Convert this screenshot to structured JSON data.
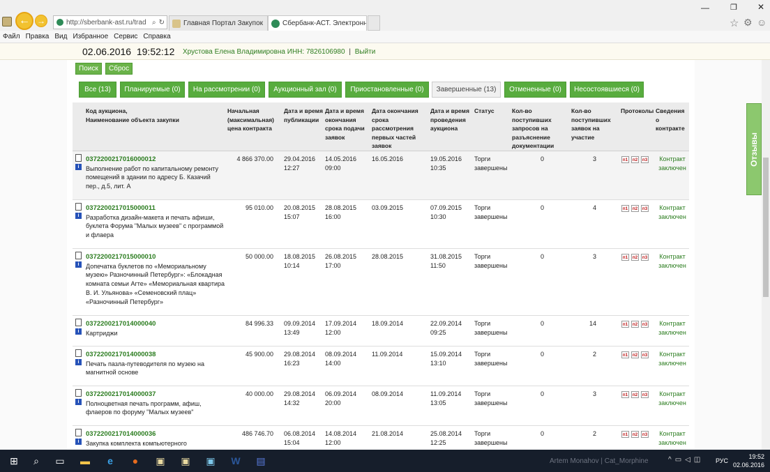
{
  "browser": {
    "url": "http://sberbank-ast.ru/trad",
    "tabs": [
      "Главная Портал Закупок",
      "Сбербанк-АСТ. Электронн..."
    ]
  },
  "menu": [
    "Файл",
    "Правка",
    "Вид",
    "Избранное",
    "Сервис",
    "Справка"
  ],
  "info": {
    "date": "02.06.2016",
    "time": "19:52:12",
    "user": "Хрустова Елена Владимировна ИНН: 7826106980",
    "separator": "|",
    "logout": "Выйти"
  },
  "buttons": {
    "search": "Поиск",
    "reset": "Сброс"
  },
  "filters": [
    "Все (13)",
    "Планируемые (0)",
    "На рассмотрении (0)",
    "Аукционный зал (0)",
    "Приостановленные (0)",
    "Завершенные (13)",
    "Отмененные (0)",
    "Несостоявшиеся (0)"
  ],
  "headers": {
    "code": "Код аукциона,",
    "name": "Наименование объекта закупки",
    "price": "Начальная (максимальная) цена контракта",
    "pub": "Дата и время публикации",
    "end_apply": "Дата и время окончания срока подачи заявок",
    "end_review": "Дата окончания срока рассмотрения первых частей заявок",
    "auction": "Дата и время проведения аукциона",
    "status": "Статус",
    "requests": "Кол-во поступивших запросов на разъяснение документации",
    "apps": "Кол-во поступивших заявок на участие",
    "protocols": "Протоколы",
    "contract": "Сведения о контракте"
  },
  "rows": [
    {
      "code": "0372200217016000012",
      "name": "Выполнение работ по капитальному ремонту помещений в здании по адресу Б. Казачий пер., д.5, лит. А",
      "price": "4 866 370.00",
      "pub_date": "29.04.2016",
      "pub_time": "12:27",
      "apply_date": "14.05.2016",
      "apply_time": "09:00",
      "review": "16.05.2016",
      "auction_date": "19.05.2016",
      "auction_time": "10:35",
      "status1": "Торги",
      "status2": "завершены",
      "requests": "0",
      "apps": "3",
      "p1": "п1",
      "p2": "п2",
      "p3": "п3",
      "contract1": "Контракт",
      "contract2": "заключен"
    },
    {
      "code": "0372200217015000011",
      "name": "Разработка дизайн-макета и печать афиши, буклета Форума \"Малых музеев\" с программой и флаера",
      "price": "95 010.00",
      "pub_date": "20.08.2015",
      "pub_time": "15:07",
      "apply_date": "28.08.2015",
      "apply_time": "16:00",
      "review": "03.09.2015",
      "auction_date": "07.09.2015",
      "auction_time": "10:30",
      "status1": "Торги",
      "status2": "завершены",
      "requests": "0",
      "apps": "4",
      "p1": "п1",
      "p2": "п2",
      "p3": "п3",
      "contract1": "Контракт",
      "contract2": "заключен"
    },
    {
      "code": "0372200217015000010",
      "name": "Допечатка буклетов по «Мемориальному музею» Разночинный Петербург»: «Блокадная комната семьи Агте» «Мемориальная квартира В. И. Ульянова» «Семеновский плац» «Разночинный Петербург»",
      "price": "50 000.00",
      "pub_date": "18.08.2015",
      "pub_time": "10:14",
      "apply_date": "26.08.2015",
      "apply_time": "17:00",
      "review": "28.08.2015",
      "auction_date": "31.08.2015",
      "auction_time": "11:50",
      "status1": "Торги",
      "status2": "завершены",
      "requests": "0",
      "apps": "3",
      "p1": "п1",
      "p2": "п2",
      "p3": "п3",
      "contract1": "Контракт",
      "contract2": "заключен"
    },
    {
      "code": "0372200217014000040",
      "name": "Картриджи",
      "price": "84 996.33",
      "pub_date": "09.09.2014",
      "pub_time": "13:49",
      "apply_date": "17.09.2014",
      "apply_time": "12:00",
      "review": "18.09.2014",
      "auction_date": "22.09.2014",
      "auction_time": "09:25",
      "status1": "Торги",
      "status2": "завершены",
      "requests": "0",
      "apps": "14",
      "p1": "п1",
      "p2": "п2",
      "p3": "п3",
      "contract1": "Контракт",
      "contract2": "заключен"
    },
    {
      "code": "0372200217014000038",
      "name": "Печать пазла-путеводителя по музею на магнитной основе",
      "price": "45 900.00",
      "pub_date": "29.08.2014",
      "pub_time": "16:23",
      "apply_date": "08.09.2014",
      "apply_time": "14:00",
      "review": "11.09.2014",
      "auction_date": "15.09.2014",
      "auction_time": "13:10",
      "status1": "Торги",
      "status2": "завершены",
      "requests": "0",
      "apps": "2",
      "p1": "п1",
      "p2": "п2",
      "p3": "п3",
      "contract1": "Контракт",
      "contract2": "заключен"
    },
    {
      "code": "0372200217014000037",
      "name": "Полноцветная печать программ, афиш, флаеров по форуму \"Малых музеев\"",
      "price": "40 000.00",
      "pub_date": "29.08.2014",
      "pub_time": "14:32",
      "apply_date": "06.09.2014",
      "apply_time": "20:00",
      "review": "08.09.2014",
      "auction_date": "11.09.2014",
      "auction_time": "13:05",
      "status1": "Торги",
      "status2": "завершены",
      "requests": "0",
      "apps": "3",
      "p1": "п1",
      "p2": "п2",
      "p3": "п3",
      "contract1": "Контракт",
      "contract2": "заключен"
    },
    {
      "code": "0372200217014000036",
      "name": "Закупка комплекта компьютерного",
      "price": "486 746.70",
      "pub_date": "06.08.2014",
      "pub_time": "15:04",
      "apply_date": "14.08.2014",
      "apply_time": "12:00",
      "review": "21.08.2014",
      "auction_date": "25.08.2014",
      "auction_time": "12:25",
      "status1": "Торги",
      "status2": "завершены",
      "requests": "0",
      "apps": "2",
      "p1": "п1",
      "p2": "п2",
      "p3": "п3",
      "contract1": "Контракт",
      "contract2": "заключен"
    }
  ],
  "feedback": "Отзывы",
  "taskbar": {
    "lang": "РУС",
    "time": "19:52",
    "date": "02.06.2016",
    "watermark": "Artem Monahov | Cat_Morphine"
  }
}
